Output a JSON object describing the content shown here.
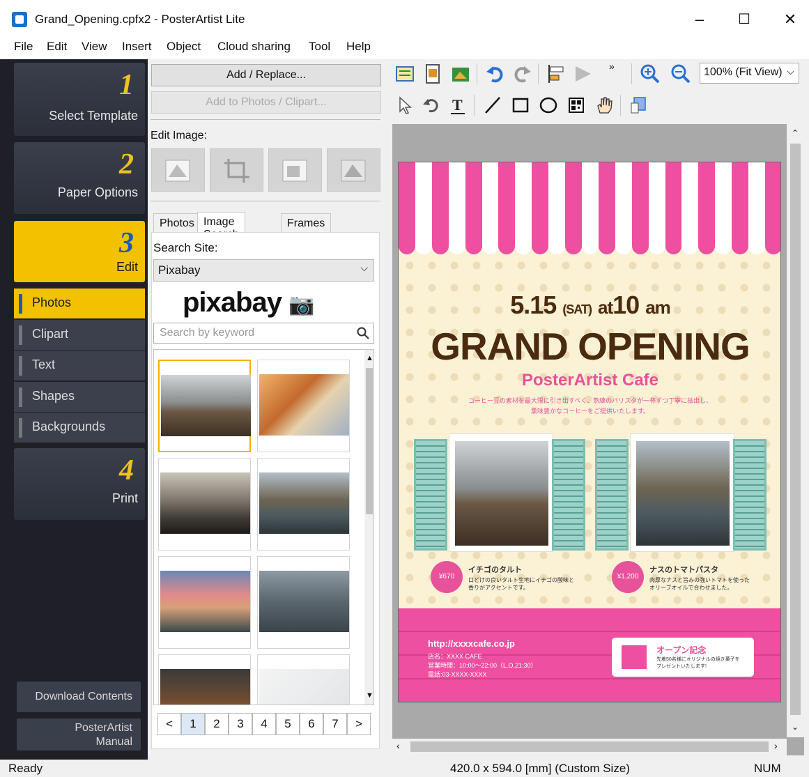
{
  "window": {
    "title": "Grand_Opening.cpfx2 - PosterArtist Lite",
    "minimize": "–",
    "maximize": "☐",
    "close": "✕"
  },
  "menu": [
    "File",
    "Edit",
    "View",
    "Insert",
    "Object",
    "Cloud sharing",
    "Tool",
    "Help"
  ],
  "steps": [
    {
      "num": "1",
      "label": "Select Template"
    },
    {
      "num": "2",
      "label": "Paper Options"
    },
    {
      "num": "3",
      "label": "Edit"
    },
    {
      "num": "4",
      "label": "Print"
    }
  ],
  "edit_subitems": [
    "Photos",
    "Clipart",
    "Text",
    "Shapes",
    "Backgrounds"
  ],
  "left_bottom": {
    "download": "Download Contents",
    "manual_line1": "PosterArtist",
    "manual_line2": "Manual"
  },
  "panel": {
    "add_replace": "Add / Replace...",
    "add_to_photos": "Add to Photos / Clipart...",
    "edit_image_label": "Edit Image:",
    "tabs": [
      "Photos",
      "Image Search",
      "Frames"
    ],
    "search_site_label": "Search Site:",
    "search_site_value": "Pixabay",
    "logo": "pixabay",
    "search_placeholder": "Search by keyword",
    "pages": [
      "1",
      "2",
      "3",
      "4",
      "5",
      "6",
      "7"
    ],
    "prev": "<",
    "next": ">"
  },
  "toolbar": {
    "zoom": "100% (Fit View)",
    "overflow": "»"
  },
  "poster": {
    "date_num": "5.15",
    "date_day": "(SAT)",
    "date_at": "at",
    "date_time": "10",
    "date_am": "am",
    "headline": "GRAND OPENING",
    "cafe": "PosterArtist Cafe",
    "tagline_1": "コーヒー豆の素材を最大限に引き出すべく、熟練のバリスタが一杯ずつ丁寧に抽出し、",
    "tagline_2": "薫味豊かなコーヒーをご提供いたします。",
    "item1_price": "¥670",
    "item1_name": "イチゴのタルト",
    "item1_desc_1": "口どけの良いタルト生地にイチゴの酸味と",
    "item1_desc_2": "香りがアクセントです。",
    "item2_price": "¥1,200",
    "item2_name": "ナスのトマトパスタ",
    "item2_desc_1": "肉厚なナスと旨みの強いトマトを使った",
    "item2_desc_2": "オリーブオイルで合わせました。",
    "url": "http://xxxxcafe.co.jp",
    "info_1": "店名：XXXX CAFE",
    "info_2": "営業時間：10:00～22:00（L.O.21:30）",
    "info_3": "電話:03-XXXX-XXXX",
    "card_title": "オープン記念",
    "card_desc_1": "先着50名様にオリジナルの焼き菓子を",
    "card_desc_2": "プレゼントいたします!",
    "colors": {
      "pink": "#ef4fa0",
      "brown": "#4a2b10",
      "cream": "#fbf2d6",
      "teal": "#9bd3c8"
    }
  },
  "status": {
    "left": "Ready",
    "center": "420.0 x 594.0 [mm] (Custom Size)",
    "right": "NUM"
  }
}
